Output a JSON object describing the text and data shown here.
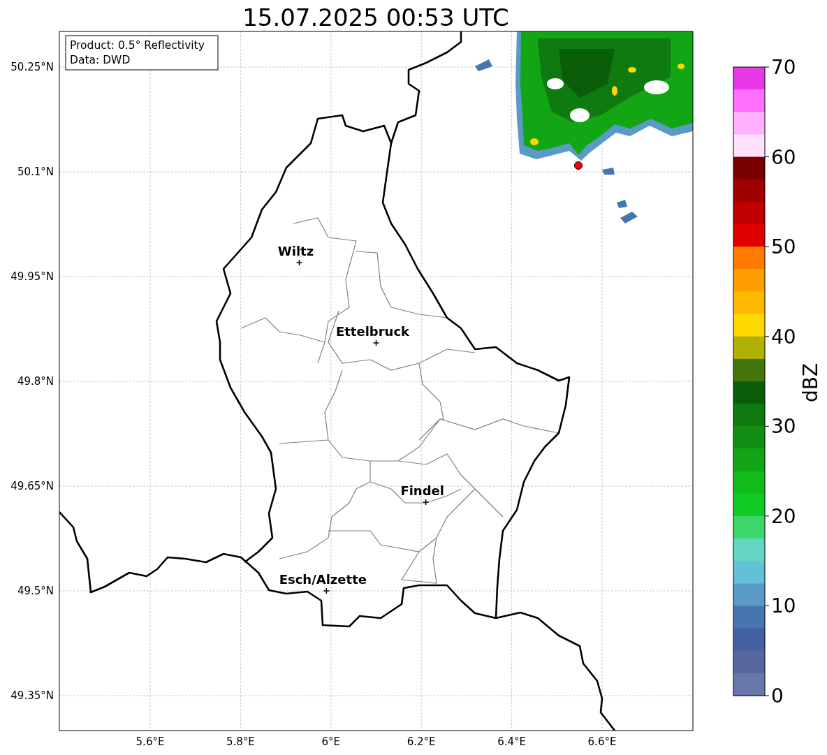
{
  "title": "15.07.2025 00:53 UTC",
  "info_box": [
    "Product: 0.5° Reflectivity",
    "Data: DWD"
  ],
  "map": {
    "lat_ticks": [
      "50.25°N",
      "50.1°N",
      "49.95°N",
      "49.8°N",
      "49.65°N",
      "49.5°N",
      "49.35°N"
    ],
    "lon_ticks": [
      "5.6°E",
      "5.8°E",
      "6°E",
      "6.2°E",
      "6.4°E",
      "6.6°E"
    ],
    "cities": [
      {
        "name": "Wiltz"
      },
      {
        "name": "Ettelbruck"
      },
      {
        "name": "Findel"
      },
      {
        "name": "Esch/Alzette"
      }
    ]
  },
  "colorbar": {
    "label": "dBZ",
    "ticks": [
      "70",
      "60",
      "50",
      "40",
      "30",
      "20",
      "10",
      "0"
    ],
    "segments": [
      {
        "color": "#e838e8"
      },
      {
        "color": "#ff70ff"
      },
      {
        "color": "#ffb0ff"
      },
      {
        "color": "#ffe0ff"
      },
      {
        "color": "#7a0000"
      },
      {
        "color": "#a00000"
      },
      {
        "color": "#c00000"
      },
      {
        "color": "#e00000"
      },
      {
        "color": "#ff7c00"
      },
      {
        "color": "#ff9c00"
      },
      {
        "color": "#ffb800"
      },
      {
        "color": "#ffd800"
      },
      {
        "color": "#b0b104"
      },
      {
        "color": "#44760b"
      },
      {
        "color": "#0a5e0a"
      },
      {
        "color": "#0e7a10"
      },
      {
        "color": "#108f13"
      },
      {
        "color": "#12a514"
      },
      {
        "color": "#13bb1a"
      },
      {
        "color": "#11c923"
      },
      {
        "color": "#3cd66a"
      },
      {
        "color": "#62d6c0"
      },
      {
        "color": "#64bfd8"
      },
      {
        "color": "#5a9ac6"
      },
      {
        "color": "#4875b0"
      },
      {
        "color": "#4360a3"
      },
      {
        "color": "#5667a0"
      },
      {
        "color": "#6877a8"
      }
    ]
  }
}
